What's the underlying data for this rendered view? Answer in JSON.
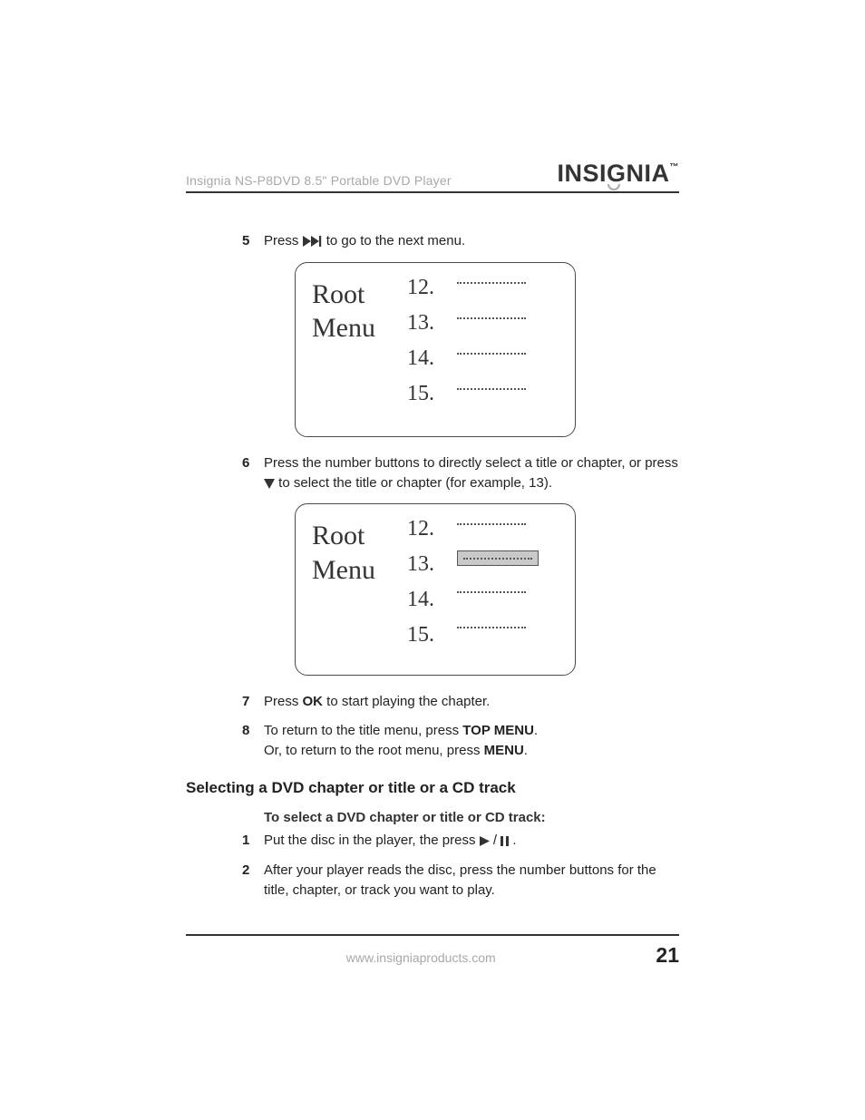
{
  "header": {
    "title": "Insignia NS-P8DVD 8.5\" Portable DVD Player",
    "brand_text_a": "INSI",
    "brand_text_g": "G",
    "brand_text_b": "NIA",
    "brand_tm": "™"
  },
  "steps": {
    "s5": {
      "num": "5",
      "pre": "Press ",
      "post": " to go to the next menu."
    },
    "s6": {
      "num": "6",
      "pre": "Press the number buttons to directly select a title or chapter, or press ",
      "post": " to select the title or chapter (for example, 13)."
    },
    "s7": {
      "num": "7",
      "pre": "Press ",
      "bold": "OK",
      "post": " to start playing the chapter."
    },
    "s8": {
      "num": "8",
      "l1a": "To return to the title menu, press ",
      "l1b": "TOP MENU",
      "l1c": ".",
      "l2a": "Or, to return to the root menu, press ",
      "l2b": "MENU",
      "l2c": "."
    },
    "s1": {
      "num": "1",
      "pre": "Put the disc in the player, the press ",
      "post": "."
    },
    "s2": {
      "num": "2",
      "text": "After your player reads the disc, press the number buttons for the title, chapter, or track you want to play."
    }
  },
  "menu": {
    "title_l1": "Root",
    "title_l2": "Menu",
    "n1": "12.",
    "n2": "13.",
    "n3": "14.",
    "n4": "15."
  },
  "section": {
    "heading": "Selecting a DVD chapter or title or a CD track",
    "subheading": "To select a DVD chapter or title or CD track:"
  },
  "footer": {
    "url": "www.insigniaproducts.com",
    "page": "21"
  }
}
